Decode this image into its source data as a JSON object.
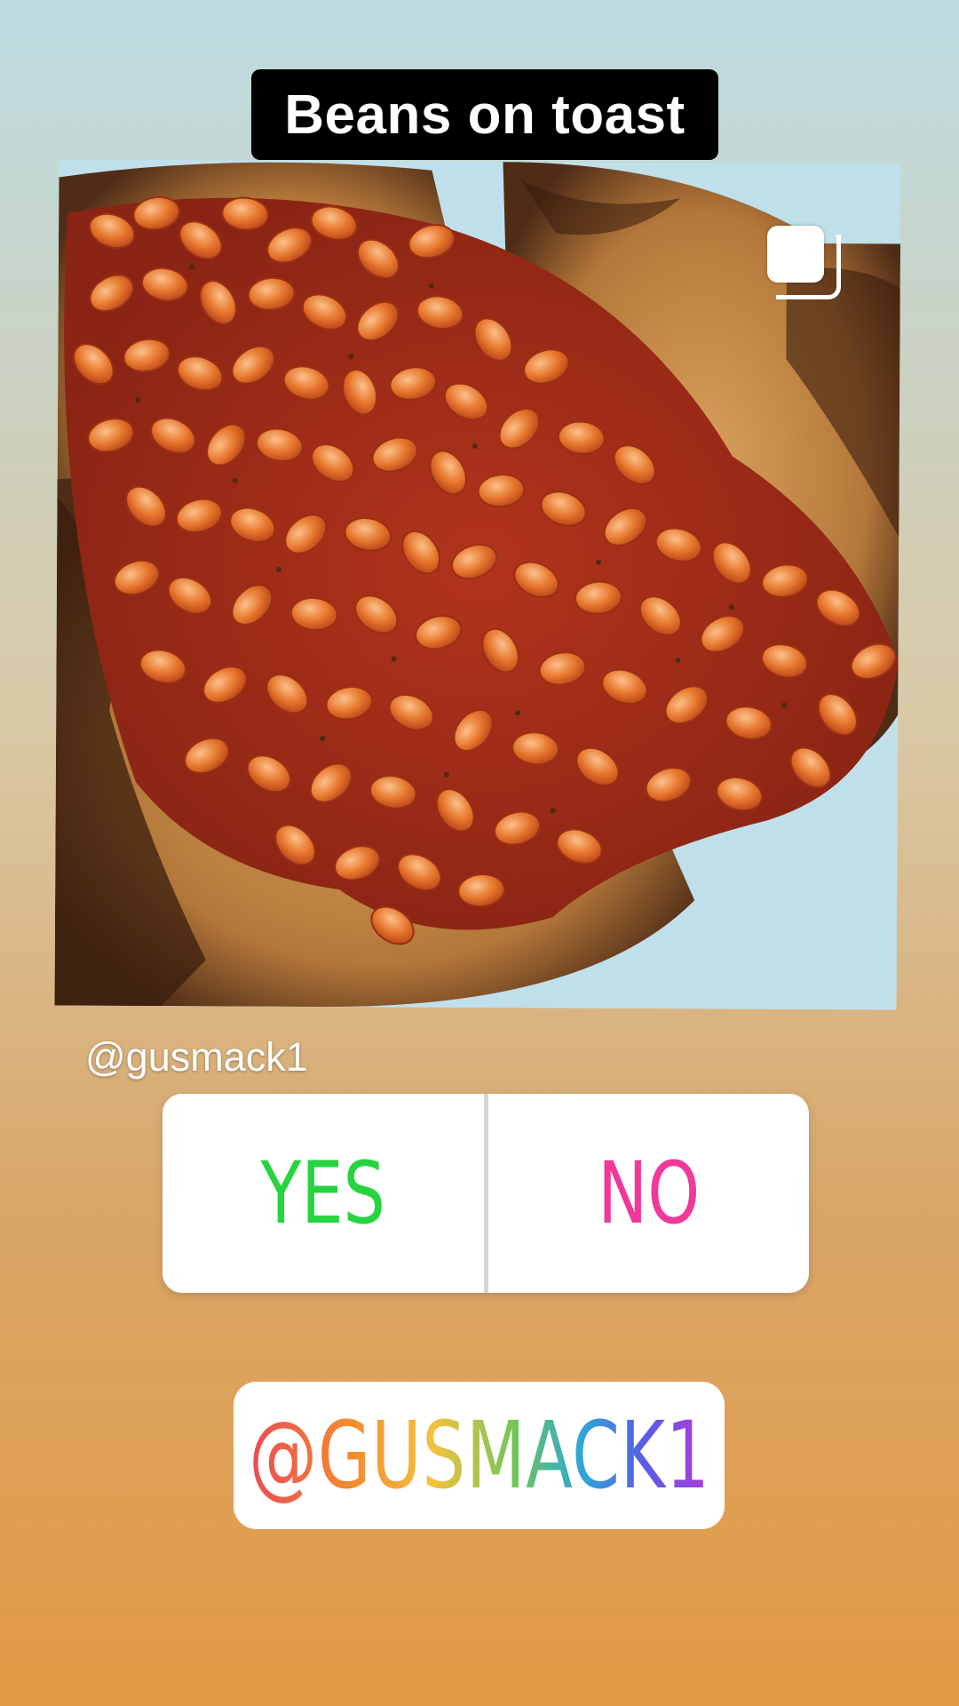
{
  "story": {
    "title": "Beans on toast",
    "photo_alt": "beans on toast",
    "photo_icon": "multiple-images-icon",
    "username": "@gusmack1"
  },
  "poll": {
    "yes_label": "YES",
    "no_label": "NO",
    "yes_color": "#27d341",
    "no_color": "#f0399b"
  },
  "mention": {
    "text": "@GUSMACK1"
  }
}
